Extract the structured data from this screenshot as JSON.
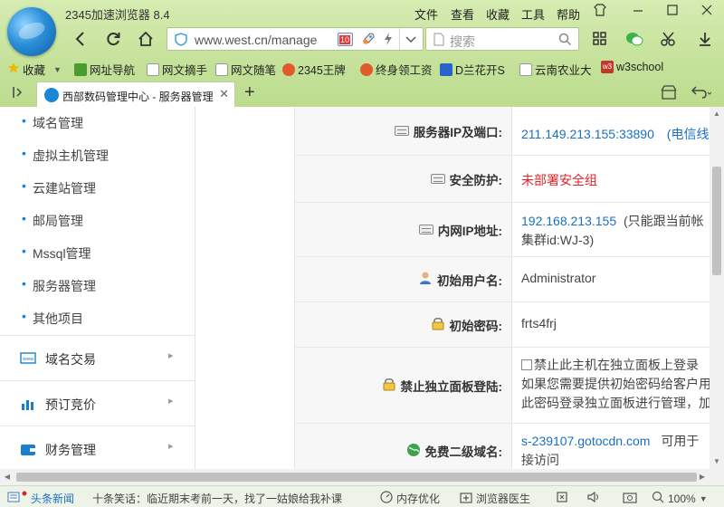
{
  "window": {
    "app_title": "2345加速浏览器 8.4",
    "menus": [
      "文件",
      "查看",
      "收藏",
      "工具",
      "帮助"
    ]
  },
  "toolbar": {
    "url": "www.west.cn/manage",
    "badge": "10",
    "search_placeholder": "搜索"
  },
  "bookmarks": [
    {
      "label": "收藏",
      "color": "#f3b800"
    },
    {
      "label": "网址导航",
      "color": "#4a9c2f"
    },
    {
      "label": "网文摘手",
      "color": "#cfcfcf"
    },
    {
      "label": "网文随笔",
      "color": "#cfcfcf"
    },
    {
      "label": "2345王牌",
      "color": "#e05a2b"
    },
    {
      "label": "终身领工资",
      "color": "#e05a2b"
    },
    {
      "label": "D兰花开S",
      "color": "#2a62c9"
    },
    {
      "label": "云南农业大",
      "color": "#cfcfcf"
    },
    {
      "label": "w3school",
      "color": "#c0392b",
      "icon_text": "w3"
    }
  ],
  "tab": {
    "label": "西部数码管理中心 - 服务器管理"
  },
  "sidebar": {
    "sub_items": [
      "域名管理",
      "虚拟主机管理",
      "云建站管理",
      "邮局管理",
      "Mssql管理",
      "服务器管理",
      "其他项目"
    ],
    "sections": [
      {
        "label": "域名交易",
        "icon": "www-icon"
      },
      {
        "label": "预订竞价",
        "icon": "bar-chart-icon"
      },
      {
        "label": "财务管理",
        "icon": "wallet-icon"
      }
    ]
  },
  "details": {
    "rows": [
      {
        "label": "服务器IP及端口:",
        "value": "211.149.213.155:33890",
        "extra": "(电信线",
        "style": "link",
        "icon": "server-icon"
      },
      {
        "label": "安全防护:",
        "value": "未部署安全组",
        "style": "red",
        "icon": "server-icon"
      },
      {
        "label": "内网IP地址:",
        "value": "192.168.213.155",
        "extra": "(只能跟当前帐",
        "line2": "集群id:WJ-3)",
        "style": "link",
        "icon": "server-icon"
      },
      {
        "label": "初始用户名:",
        "value": "Administrator",
        "style": "plain",
        "icon": "user-icon"
      },
      {
        "label": "初始密码:",
        "value": "frts4frj",
        "style": "plain",
        "icon": "lock-icon"
      },
      {
        "label": "禁止独立面板登陆:",
        "value": "禁止此主机在独立面板上登录",
        "line2": "如果您需要提供初始密码给客户用",
        "line3": "此密码登录独立面板进行管理，加",
        "style": "checkbox",
        "icon": "lock-icon"
      },
      {
        "label": "免费二级域名:",
        "value": "s-239107.gotocdn.com",
        "extra": "可用于",
        "line2": "接访问",
        "style": "link",
        "icon": "globe-icon"
      }
    ]
  },
  "statusbar": {
    "news": "头条新闻",
    "ticker": "十条笑话：临近期末考前一天，找了一姑娘给我补课",
    "memory": "内存优化",
    "doctor": "浏览器医生",
    "zoom": "100%"
  }
}
